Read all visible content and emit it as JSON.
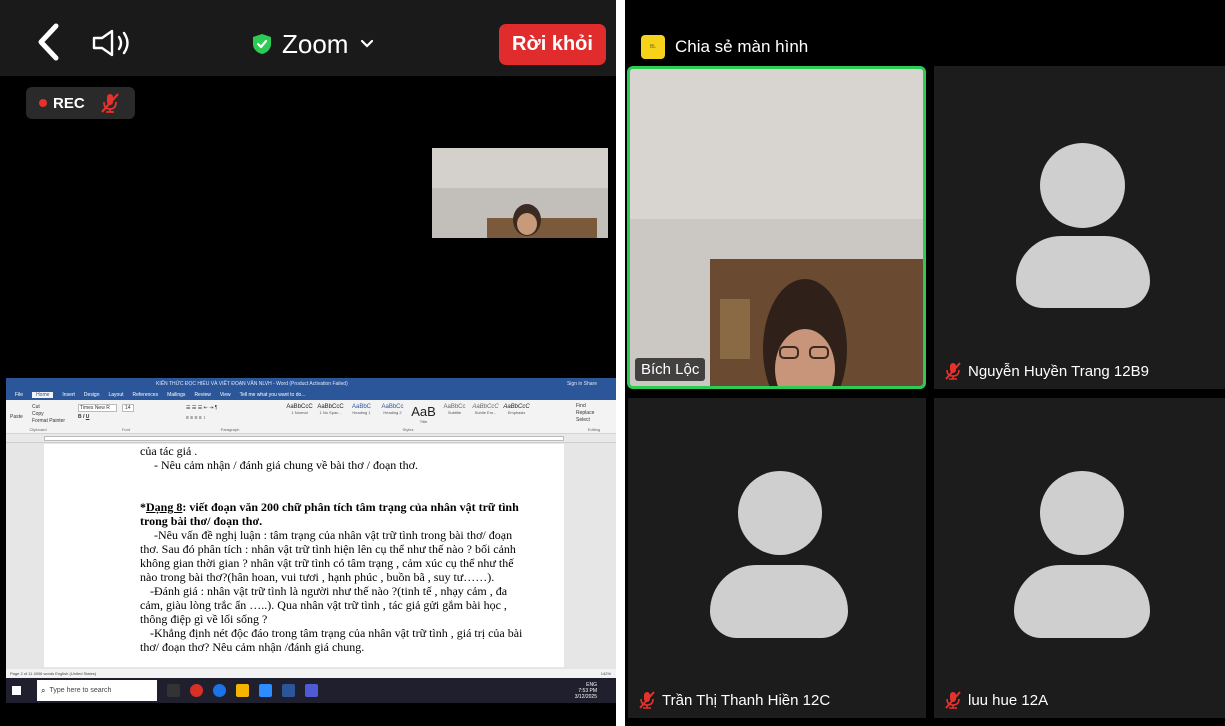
{
  "left_call": {
    "app_title": "Zoom",
    "leave_label": "Rời khỏi",
    "rec_label": "REC",
    "icons": [
      "back-chevron-icon",
      "speaker-icon",
      "shield-check-icon",
      "chevron-down-icon",
      "mic-muted-icon"
    ],
    "colors": {
      "leave_button": "#e02c2c",
      "shield": "#2dca54",
      "rec_dot": "#e5322d"
    }
  },
  "word": {
    "title_text": "KIẾN THỨC ĐỌC HIỂU VÀ VIẾT ĐOẠN VĂN NLVH - Word (Product Activation Failed)",
    "sign_in": "Sign in   Share",
    "tabs": [
      "File",
      "Home",
      "Insert",
      "Design",
      "Layout",
      "References",
      "Mailings",
      "Review",
      "View",
      "Tell me what you want to do..."
    ],
    "ribbon": {
      "clipboard": "Clipboard",
      "font": "Font",
      "font_name": "Times New R",
      "font_size": "14",
      "paragraph": "Paragraph",
      "styles_group": "Styles",
      "editing": "Editing",
      "find": "Find",
      "replace": "Replace",
      "select": "Select",
      "paste": "Paste",
      "cut": "Cut",
      "copy": "Copy",
      "format_painter": "Format Painter",
      "styles": [
        {
          "preview": "AaBbCcC",
          "name": "1 Normal"
        },
        {
          "preview": "AaBbCcC",
          "name": "1 No Spac..."
        },
        {
          "preview": "AaBbC",
          "name": "Heading 1"
        },
        {
          "preview": "AaBbCc",
          "name": "Heading 2"
        },
        {
          "preview": "AaB",
          "name": "Title"
        },
        {
          "preview": "AaBbCc",
          "name": "Subtitle"
        },
        {
          "preview": "AaBbCcC",
          "name": "Subtle Em..."
        },
        {
          "preview": "AaBbCcC",
          "name": "Emphasis"
        }
      ]
    },
    "doc": {
      "l1": "của tác giả .",
      "l2": "- Nêu cảm nhận / đánh giá chung về bài thơ / đoạn thơ.",
      "head_label": "Dạng 8",
      "head_rest": ": viết đoạn văn 200 chữ phân tích tâm trạng của nhân vật trữ tình trong bài thơ/ đoạn thơ.",
      "p1": "-Nêu vấn đề nghị luận : tâm trạng của nhân vật trữ tình trong bài thơ/ đoạn thơ. Sau đó phân tích : nhân vật trữ tình hiện lên cụ thể như thế nào ? bối cảnh không gian thời gian ? nhân vật trữ tình có tâm trạng , cảm xúc cụ thể như thế nào trong bài thơ?(hân hoan, vui tươi , hạnh phúc , buồn bã , suy tư……).",
      "p2": "-Đánh giá : nhân vật trữ tình là người như thế nào ?(tinh tế , nhạy cảm , đa cảm, giàu lòng trắc ẩn …..). Qua nhân vật trữ tình , tác giả gửi gắm bài học , thông điệp gì về lối sống ?",
      "p3": "-Khẳng định nét độc đáo trong tâm trạng của nhân vật trữ tình , giá trị của bài thơ/ đoạn thơ? Nêu cảm nhận /đánh giá chung."
    },
    "status": "Page 2 of 11   4006 words   English (United States)",
    "zoom": "142%",
    "search_placeholder": "Type here to search",
    "time": "7:53 PM",
    "date": "3/12/2025",
    "lang": "ENG"
  },
  "right_call": {
    "share_label": "Chia sẻ màn hình",
    "share_icon_text": "BL",
    "participants": [
      {
        "name": "Bích Lộc",
        "muted": false,
        "active_speaker": true
      },
      {
        "name": "Nguyễn Huyền Trang 12B9",
        "muted": true
      },
      {
        "name": "Trần Thị Thanh Hiền 12C",
        "muted": true
      },
      {
        "name": "luu hue 12A",
        "muted": true
      }
    ],
    "colors": {
      "active_border": "#2dca54",
      "share_icon": "#f7d21b",
      "mute_icon": "#e5322d"
    }
  }
}
